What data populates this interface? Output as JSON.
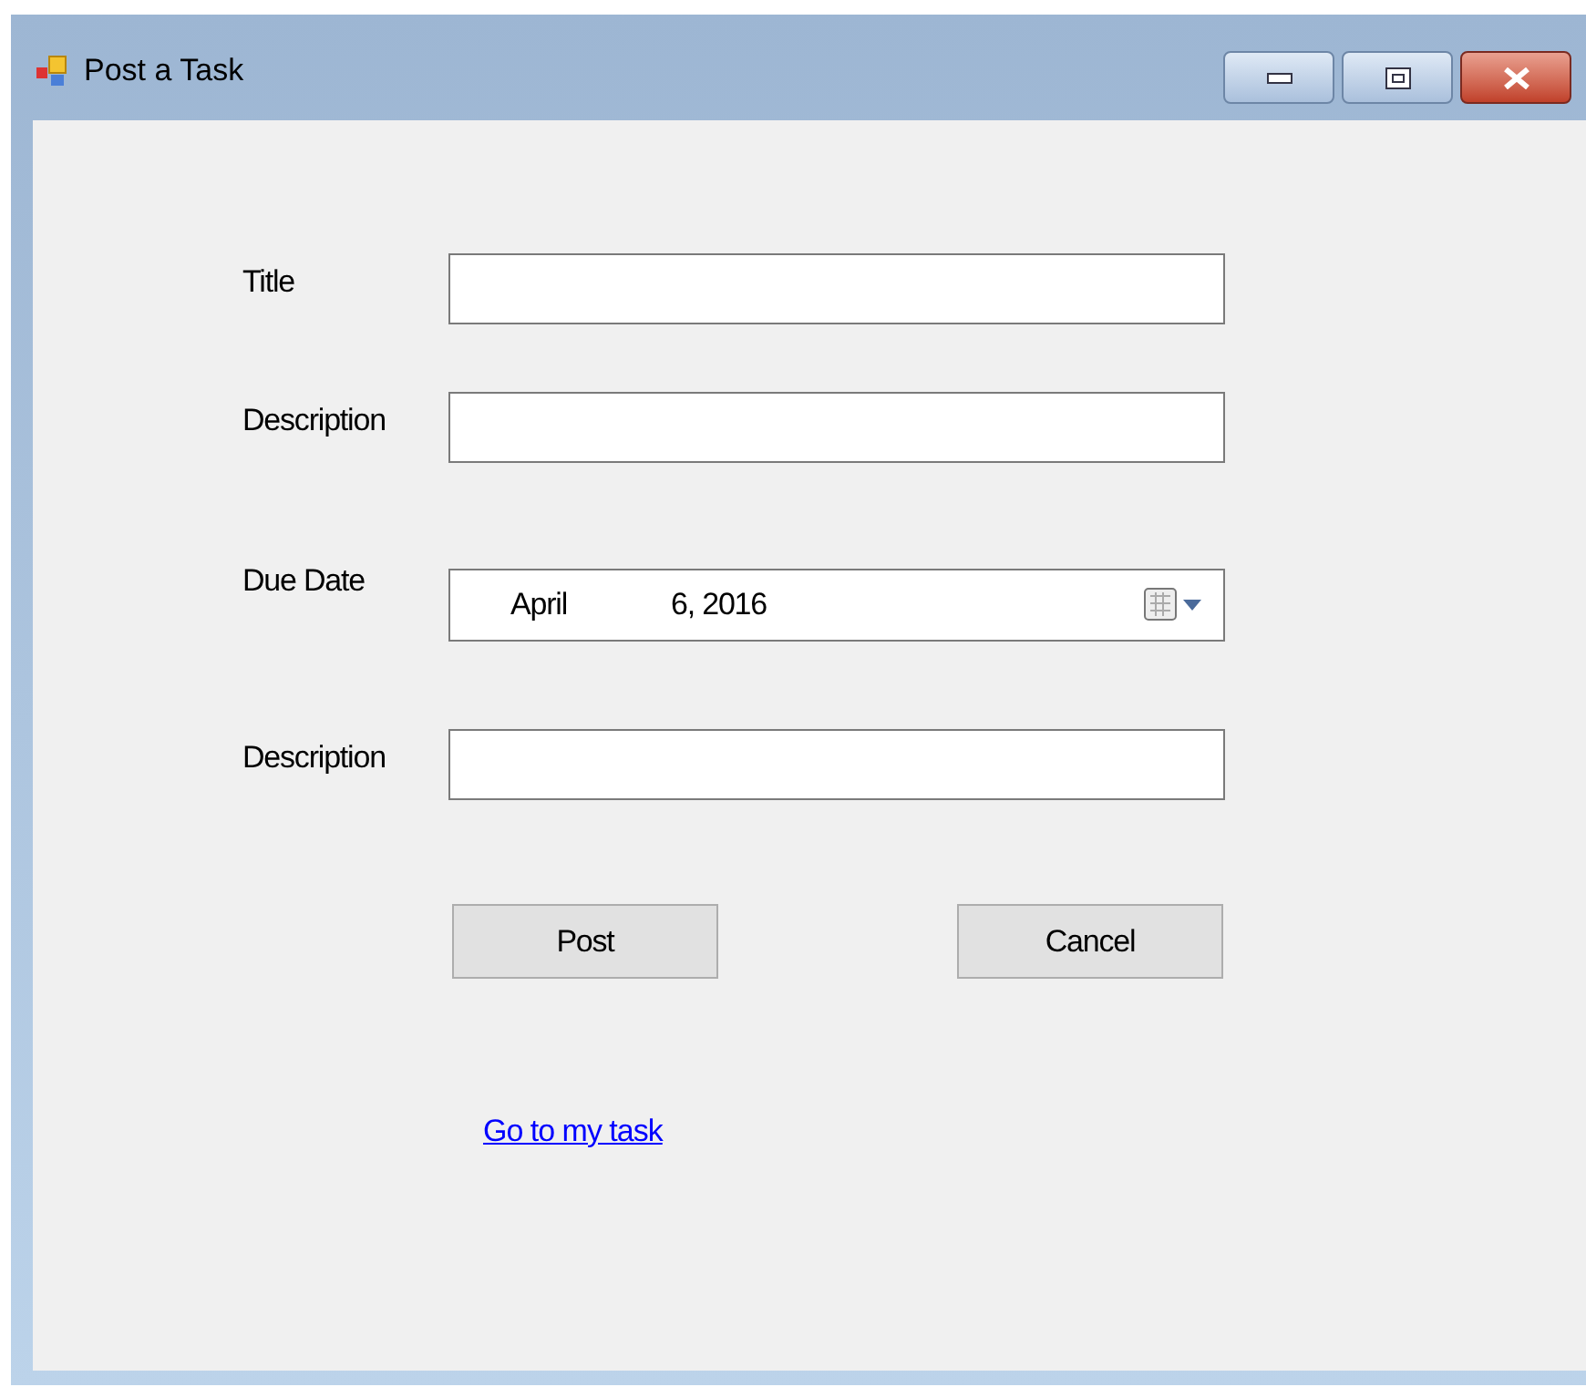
{
  "window": {
    "title": "Post a Task"
  },
  "fields": [
    {
      "kind": "text",
      "label": "Title"
    },
    {
      "kind": "text",
      "label": "Description"
    },
    {
      "kind": "date",
      "label": "Due Date",
      "month": "April",
      "day_year": "6, 2016"
    },
    {
      "kind": "text",
      "label": "Description"
    }
  ],
  "buttons": [
    "Post",
    "Cancel"
  ],
  "link": "Go to my task"
}
